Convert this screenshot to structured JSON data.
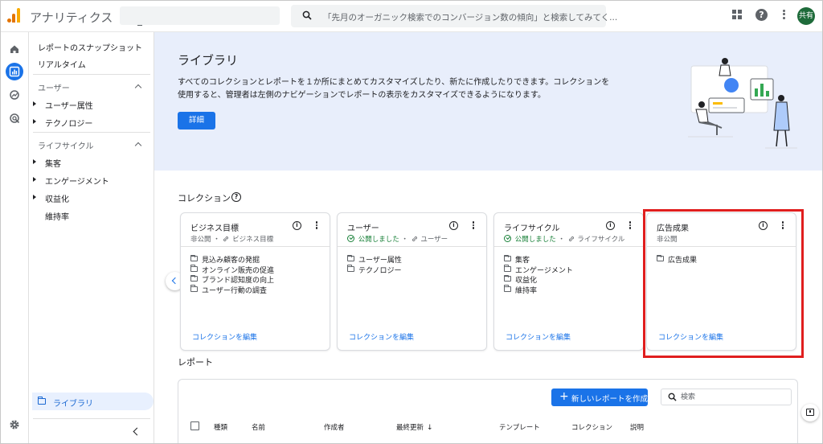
{
  "app": {
    "title": "アナリティクス"
  },
  "search": {
    "placeholder": "「先月のオーガニック検索でのコンバージョン数の傾向」と検索してみてく..."
  },
  "header": {
    "avatar_label": "共有",
    "help_glyph": "?"
  },
  "sidebar": {
    "items": [
      {
        "label": "レポートのスナップショット"
      },
      {
        "label": "リアルタイム"
      }
    ],
    "sections": [
      {
        "heading": "ユーザー",
        "items": [
          {
            "label": "ユーザー属性"
          },
          {
            "label": "テクノロジー"
          }
        ]
      },
      {
        "heading": "ライフサイクル",
        "items": [
          {
            "label": "集客"
          },
          {
            "label": "エンゲージメント"
          },
          {
            "label": "収益化"
          },
          {
            "label": "維持率"
          }
        ]
      }
    ],
    "library_label": "ライブラリ"
  },
  "hero": {
    "title": "ライブラリ",
    "description": "すべてのコレクションとレポートを１か所にまとめてカスタマイズしたり、新たに作成したりできます。コレクションを使用すると、管理者は左側のナビゲーションでレポートの表示をカスタマイズできるようになります。",
    "button_label": "詳細"
  },
  "collections": {
    "title": "コレクション",
    "help_glyph": "?",
    "cards": [
      {
        "title": "ビジネス目標",
        "status": "非公開",
        "published": false,
        "linked": "ビジネス目標",
        "items": [
          "見込み顧客の発掘",
          "オンライン販売の促進",
          "ブランド認知度の向上",
          "ユーザー行動の調査"
        ],
        "edit_label": "コレクションを編集"
      },
      {
        "title": "ユーザー",
        "status": "公開しました",
        "published": true,
        "linked": "ユーザー",
        "items": [
          "ユーザー属性",
          "テクノロジー"
        ],
        "edit_label": "コレクションを編集"
      },
      {
        "title": "ライフサイクル",
        "status": "公開しました",
        "published": true,
        "linked": "ライフサイクル",
        "items": [
          "集客",
          "エンゲージメント",
          "収益化",
          "維持率"
        ],
        "edit_label": "コレクションを編集"
      },
      {
        "title": "広告成果",
        "status": "非公開",
        "published": false,
        "linked": "",
        "items": [
          "広告成果"
        ],
        "edit_label": "コレクションを編集"
      }
    ],
    "info_glyph": "i",
    "status_separator": "・"
  },
  "reports": {
    "title": "レポート",
    "new_button_label": "新しいレポートを作成",
    "new_button_icon": "+",
    "search_placeholder": "検索",
    "columns": [
      "種類",
      "名前",
      "作成者",
      "最終更新",
      "テンプレート",
      "コレクション",
      "説明"
    ],
    "sort_glyph": "↓"
  },
  "colors": {
    "accent": "#1a73e8",
    "highlight": "#e01e1e",
    "hero_bg": "#e8eefb",
    "published": "#188038"
  }
}
